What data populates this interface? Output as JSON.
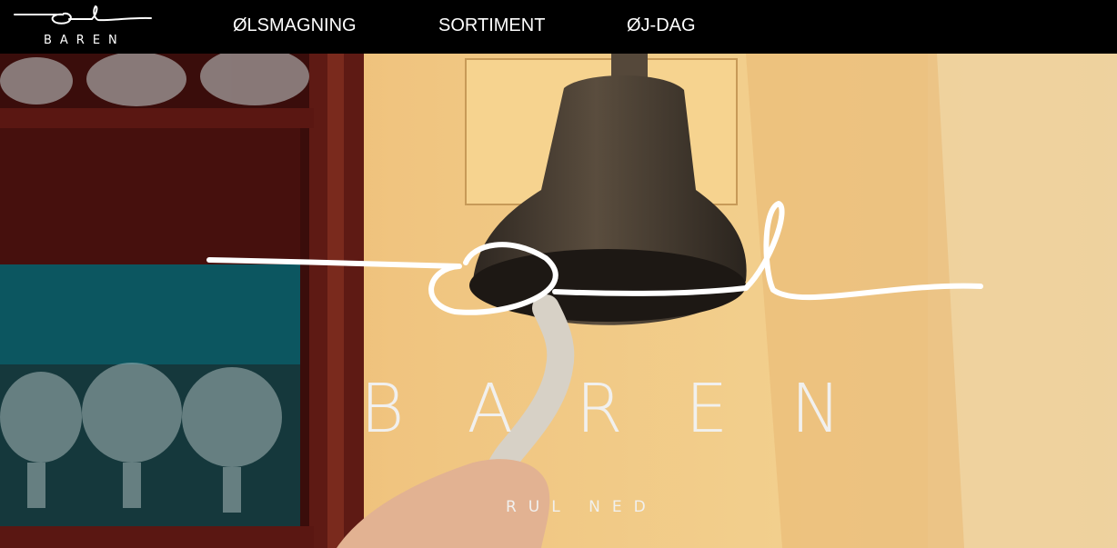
{
  "brand": {
    "logo_text": "BAREN"
  },
  "nav": {
    "items": [
      {
        "label": "ØLSMAGNING"
      },
      {
        "label": "SORTIMENT"
      },
      {
        "label": "ØJ-DAG"
      }
    ]
  },
  "hero": {
    "title": "BAREN",
    "scroll_hint": "RUL NED"
  },
  "colors": {
    "topbar": "#000000",
    "text": "#ffffff",
    "wall": "#e9c27a",
    "shelf": "#4b1210",
    "bell": "#3b3228"
  }
}
